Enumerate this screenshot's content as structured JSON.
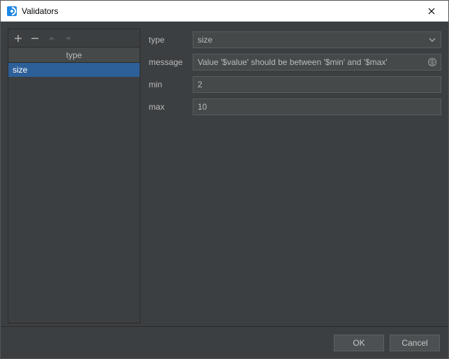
{
  "window": {
    "title": "Validators"
  },
  "toolbar": {
    "add_tip": "Add",
    "remove_tip": "Remove",
    "up_tip": "Move Up",
    "down_tip": "Move Down"
  },
  "table": {
    "header": "type",
    "rows": [
      {
        "type": "size",
        "selected": true
      }
    ]
  },
  "form": {
    "type": {
      "label": "type",
      "value": "size"
    },
    "message": {
      "label": "message",
      "value": "Value '$value' should be between '$min' and '$max'"
    },
    "min": {
      "label": "min",
      "value": "2"
    },
    "max": {
      "label": "max",
      "value": "10"
    }
  },
  "buttons": {
    "ok": "OK",
    "cancel": "Cancel"
  }
}
